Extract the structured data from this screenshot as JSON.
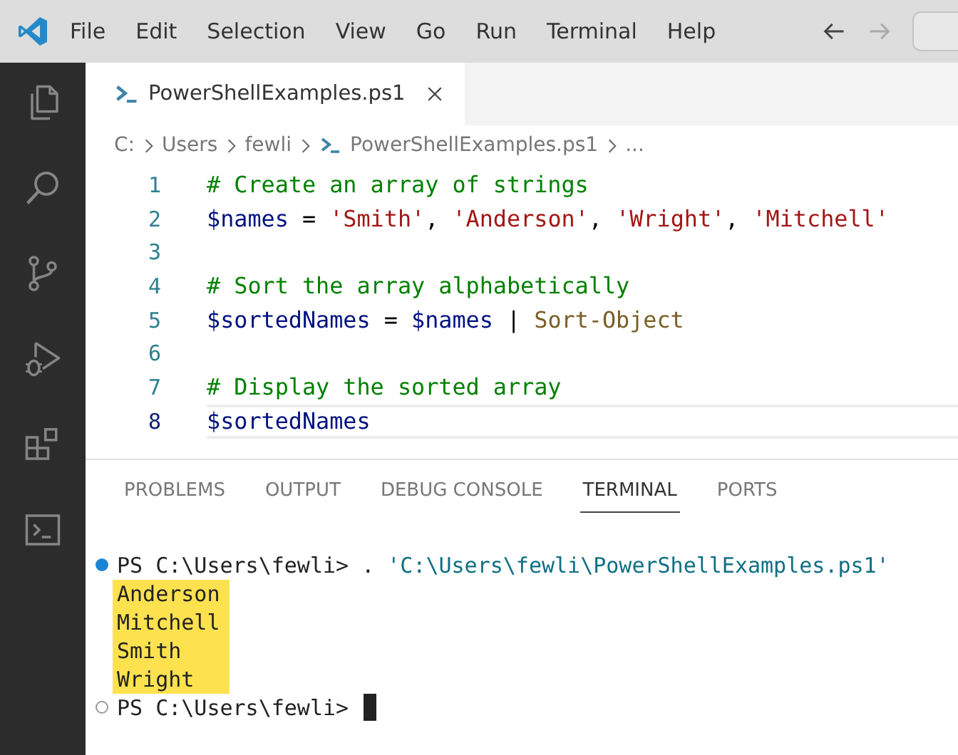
{
  "menu_bar": {
    "items": [
      "File",
      "Edit",
      "Selection",
      "View",
      "Go",
      "Run",
      "Terminal",
      "Help"
    ],
    "back_disabled": false,
    "forward_disabled": true
  },
  "activity_bar": {
    "items": [
      {
        "kind": "explorer",
        "selected": false
      },
      {
        "kind": "search",
        "selected": false
      },
      {
        "kind": "source-control",
        "selected": false
      },
      {
        "kind": "debug",
        "selected": false
      },
      {
        "kind": "extensions",
        "selected": false
      },
      {
        "kind": "terminal",
        "selected": false
      }
    ]
  },
  "editor_tabs": [
    {
      "label": "PowerShellExamples.ps1",
      "selected": true
    }
  ],
  "breadcrumb": [
    {
      "label": "C:",
      "kind": "folder"
    },
    {
      "label": "Users",
      "kind": "folder"
    },
    {
      "label": "fewli",
      "kind": "folder"
    },
    {
      "label": "PowerShellExamples.ps1",
      "kind": "file"
    },
    {
      "label": "...",
      "kind": "more"
    }
  ],
  "code_lines": [
    {
      "number": "1",
      "current": false,
      "tokens": [
        {
          "kind": "comment",
          "text": "# Create an array of strings"
        }
      ]
    },
    {
      "number": "2",
      "current": false,
      "tokens": [
        {
          "kind": "variable",
          "text": "$names"
        },
        {
          "kind": "plain",
          "text": " = "
        },
        {
          "kind": "string",
          "text": "'Smith'"
        },
        {
          "kind": "plain",
          "text": ", "
        },
        {
          "kind": "string",
          "text": "'Anderson'"
        },
        {
          "kind": "plain",
          "text": ", "
        },
        {
          "kind": "string",
          "text": "'Wright'"
        },
        {
          "kind": "plain",
          "text": ", "
        },
        {
          "kind": "string",
          "text": "'Mitchell'"
        }
      ]
    },
    {
      "number": "3",
      "current": false
    },
    {
      "number": "4",
      "current": false,
      "tokens": [
        {
          "kind": "comment",
          "text": "# Sort the array alphabetically"
        }
      ]
    },
    {
      "number": "5",
      "current": false,
      "tokens": [
        {
          "kind": "variable",
          "text": "$sortedNames"
        },
        {
          "kind": "plain",
          "text": " = "
        },
        {
          "kind": "variable",
          "text": "$names"
        },
        {
          "kind": "plain",
          "text": " | "
        },
        {
          "kind": "command",
          "text": "Sort-Object"
        }
      ]
    },
    {
      "number": "6",
      "current": false
    },
    {
      "number": "7",
      "current": false,
      "tokens": [
        {
          "kind": "comment",
          "text": "# Display the sorted array"
        }
      ]
    },
    {
      "number": "8",
      "current": true,
      "tokens": [
        {
          "kind": "variable",
          "text": "$sortedNames"
        }
      ]
    }
  ],
  "panel_tabs": [
    {
      "label": "PROBLEMS",
      "selected": false
    },
    {
      "label": "OUTPUT",
      "selected": false
    },
    {
      "label": "DEBUG CONSOLE",
      "selected": false
    },
    {
      "label": "TERMINAL",
      "selected": true
    },
    {
      "label": "PORTS",
      "selected": false
    }
  ],
  "terminal_lines": [
    {
      "kind": "command",
      "succeeded": true,
      "prompt": "PS C:\\Users\\fewli>",
      "command": ". ",
      "argument": "'C:\\Users\\fewli\\PowerShellExamples.ps1'"
    },
    {
      "kind": "output",
      "text": "Anderson",
      "highlighted": true
    },
    {
      "kind": "output",
      "text": "Mitchell",
      "highlighted": true
    },
    {
      "kind": "output",
      "text": "Smith",
      "highlighted": true
    },
    {
      "kind": "output",
      "text": "Wright",
      "highlighted": true
    },
    {
      "kind": "command",
      "succeeded": false,
      "prompt": "PS C:\\Users\\fewli>",
      "cursor": true
    }
  ]
}
